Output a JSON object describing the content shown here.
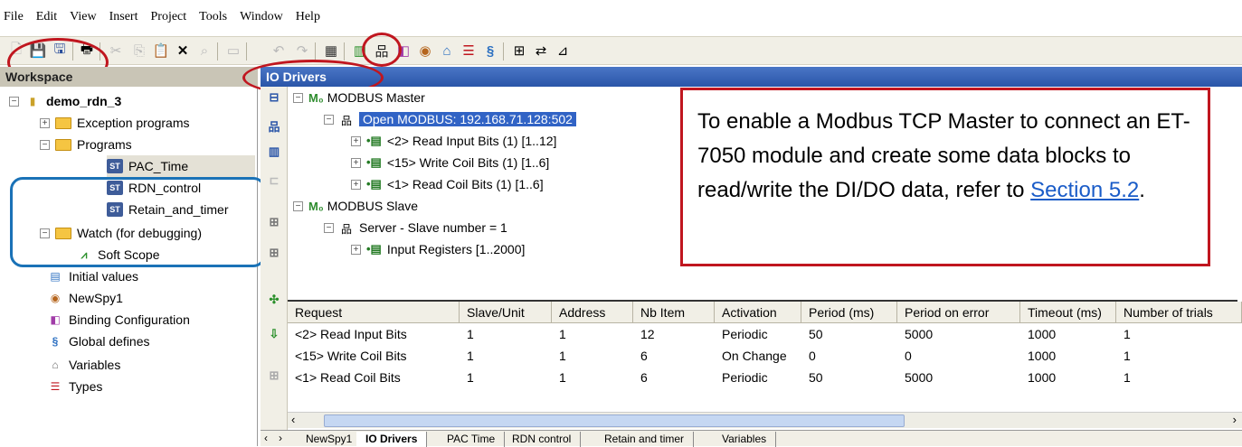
{
  "menu": [
    "File",
    "Edit",
    "View",
    "Insert",
    "Project",
    "Tools",
    "Window",
    "Help"
  ],
  "workspace": {
    "title": "Workspace",
    "project": "demo_rdn_3",
    "items": [
      "Exception programs",
      "Programs",
      "PAC_Time",
      "RDN_control",
      "Retain_and_timer",
      "Watch (for debugging)",
      "Soft Scope",
      "Initial values",
      "NewSpy1",
      "Binding Configuration",
      "Global defines",
      "Variables",
      "Types"
    ]
  },
  "io": {
    "title": "IO Drivers",
    "master": "MODBUS Master",
    "open": "Open MODBUS: 192.168.71.128:502",
    "blocks": [
      "<2> Read Input Bits (1) [1..12]",
      "<15> Write Coil Bits (1) [1..6]",
      "<1> Read Coil Bits (1) [1..6]"
    ],
    "slave": "MODBUS Slave",
    "server": "Server - Slave number = 1",
    "input_regs": "Input Registers [1..2000]"
  },
  "callout": {
    "text": "To enable a Modbus TCP Master to connect an ET-7050 module and create some data blocks to read/write the DI/DO data, refer to ",
    "link": "Section 5.2",
    "end": "."
  },
  "grid": {
    "headers": [
      "Request",
      "Slave/Unit",
      "Address",
      "Nb Item",
      "Activation",
      "Period (ms)",
      "Period on error",
      "Timeout (ms)",
      "Number of trials"
    ],
    "rows": [
      [
        "<2> Read Input Bits",
        "1",
        "1",
        "12",
        "Periodic",
        "50",
        "5000",
        "1000",
        "1"
      ],
      [
        "<15> Write Coil Bits",
        "1",
        "1",
        "6",
        "On Change",
        "0",
        "0",
        "1000",
        "1"
      ],
      [
        "<1> Read Coil Bits",
        "1",
        "1",
        "6",
        "Periodic",
        "50",
        "5000",
        "1000",
        "1"
      ]
    ]
  },
  "tabs": [
    "NewSpy1",
    "IO Drivers",
    "PAC Time",
    "RDN control",
    "Retain and timer",
    "Variables"
  ],
  "colors": {
    "highlight": "#3163c5",
    "annotation_red": "#c0161f",
    "annotation_blue": "#1a72b7",
    "link": "#1a5cc8"
  }
}
